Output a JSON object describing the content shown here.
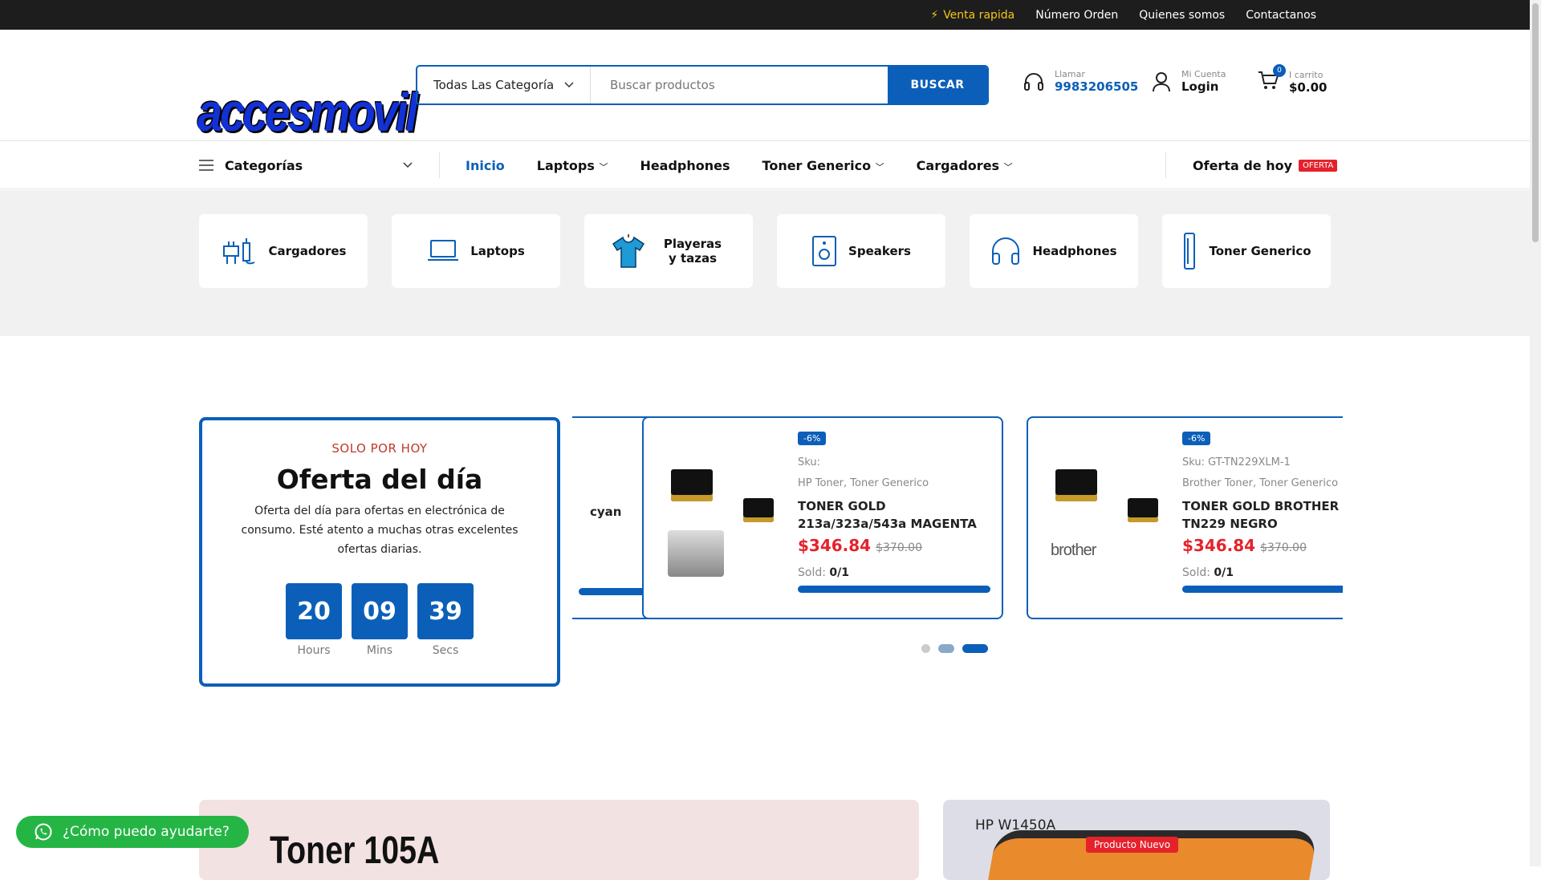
{
  "topbar": {
    "promo": "Venta rapida",
    "links": [
      "Número Orden",
      "Quienes somos",
      "Contactanos"
    ]
  },
  "header": {
    "logo": "accesmovil",
    "search": {
      "category": "Todas Las Categorías",
      "placeholder": "Buscar productos",
      "button": "BUSCAR"
    },
    "call": {
      "label": "Llamar",
      "phone": "9983206505"
    },
    "account": {
      "label": "Mi Cuenta",
      "action": "Login"
    },
    "cart": {
      "count": "0",
      "label": "I carrito",
      "total": "$0.00"
    }
  },
  "nav": {
    "categories": "Categorías",
    "items": [
      "Inicio",
      "Laptops",
      "Headphones",
      "Toner Generico",
      "Cargadores"
    ],
    "offer": "Oferta de hoy",
    "offer_tag": "OFERTA"
  },
  "categories": [
    "Cargadores",
    "Laptops",
    "Playeras y tazas",
    "Speakers",
    "Headphones",
    "Toner Generico"
  ],
  "deal": {
    "kicker": "SOLO POR HOY",
    "title": "Oferta del día",
    "text": "Oferta del día para ofertas en electrónica de consumo. Esté atento a muchas otras excelentes ofertas diarias.",
    "timer": [
      {
        "value": "20",
        "label": "Hours"
      },
      {
        "value": "09",
        "label": "Mins"
      },
      {
        "value": "39",
        "label": "Secs"
      }
    ]
  },
  "products": {
    "partial_text": "cyan",
    "items": [
      {
        "discount": "-6%",
        "sku": "Sku:",
        "categories": "HP Toner, Toner Generico",
        "name": "TONER GOLD 213a/323a/543a MAGENTA",
        "price": "$346.84",
        "old_price": "$370.00",
        "sold_label": "Sold:",
        "sold": "0/1",
        "sold_fraction": 1.0
      },
      {
        "discount": "-6%",
        "sku": "Sku: GT-TN229XLM-1",
        "categories": "Brother Toner, Toner Generico",
        "name": "TONER GOLD BROTHER TN229 NEGRO",
        "price": "$346.84",
        "old_price": "$370.00",
        "sold_label": "Sold:",
        "sold": "0/1",
        "sold_fraction": 1.0,
        "brand": "brother"
      }
    ]
  },
  "banners": {
    "left_title": "Toner 105A",
    "right_title": "HP W1450A",
    "right_tag": "Producto Nuevo"
  },
  "whatsapp": "¿Cómo puedo ayudarte?",
  "colors": {
    "accent": "#0b5fb8",
    "sale": "#e5222b",
    "whatsapp": "#25b545"
  }
}
